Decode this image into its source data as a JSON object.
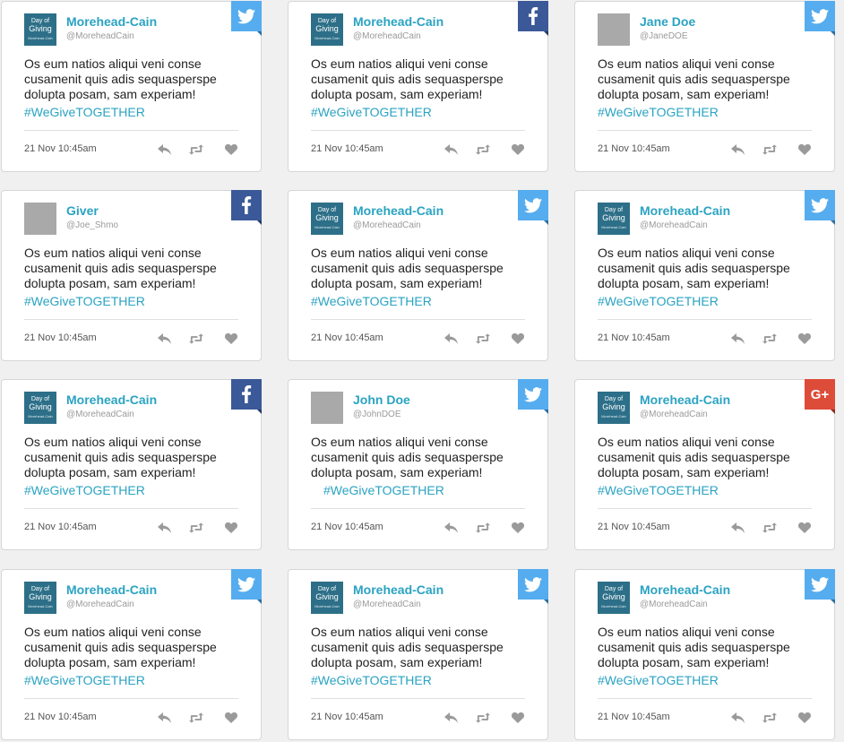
{
  "posts": [
    {
      "name": "Morehead-Cain",
      "handle": "@MoreheadCain",
      "avatar": "logo",
      "network": "twitter-icon",
      "text": "Os eum natios aliqui veni conse cusamenit quis adis sequasperspe dolupta posam, sam experiam!",
      "hashtag": "#WeGiveTOGETHER",
      "date": "21 Nov 10:45am"
    },
    {
      "name": "Morehead-Cain",
      "handle": "@MoreheadCain",
      "avatar": "logo",
      "network": "facebook-icon",
      "text": "Os eum natios aliqui veni conse cusamenit quis adis sequasperspe dolupta posam, sam experiam!",
      "hashtag": "#WeGiveTOGETHER",
      "date": "21 Nov 10:45am"
    },
    {
      "name": "Jane Doe",
      "handle": "@JaneDOE",
      "avatar": "grey",
      "network": "twitter-icon",
      "text": "Os eum natios aliqui veni conse cusamenit quis adis sequasperspe dolupta posam, sam experiam!",
      "hashtag": "#WeGiveTOGETHER",
      "date": "21 Nov 10:45am"
    },
    {
      "name": "Giver",
      "handle": "@Joe_Shmo",
      "avatar": "grey",
      "network": "facebook-icon",
      "text": "Os eum natios aliqui veni conse cusamenit quis adis sequasperspe dolupta posam, sam experiam!",
      "hashtag": "#WeGiveTOGETHER",
      "date": "21 Nov 10:45am"
    },
    {
      "name": "Morehead-Cain",
      "handle": "@MoreheadCain",
      "avatar": "logo",
      "network": "twitter-icon",
      "text": "Os eum natios aliqui veni conse cusamenit quis adis sequasperspe dolupta posam, sam experiam!",
      "hashtag": "#WeGiveTOGETHER",
      "date": "21 Nov 10:45am"
    },
    {
      "name": "Morehead-Cain",
      "handle": "@MoreheadCain",
      "avatar": "logo",
      "network": "twitter-icon",
      "text": "Os eum natios aliqui veni conse cusamenit quis adis sequasperspe dolupta posam, sam experiam!",
      "hashtag": "#WeGiveTOGETHER",
      "date": "21 Nov 10:45am"
    },
    {
      "name": "Morehead-Cain",
      "handle": "@MoreheadCain",
      "avatar": "logo",
      "network": "facebook-icon",
      "text": "Os eum natios aliqui veni conse cusamenit quis adis sequasperspe dolupta posam, sam experiam!",
      "hashtag": "#WeGiveTOGETHER",
      "date": "21 Nov 10:45am"
    },
    {
      "name": "John Doe",
      "handle": "@JohnDOE",
      "avatar": "grey",
      "network": "twitter-icon",
      "text": "Os eum natios aliqui veni conse cusamenit quis adis sequasperspe dolupta posam, sam experiam!",
      "hashtag": "#WeGiveTOGETHER",
      "date": "21 Nov 10:45am"
    },
    {
      "name": "Morehead-Cain",
      "handle": "@MoreheadCain",
      "avatar": "logo",
      "network": "google-plus-icon",
      "text": "Os eum natios aliqui veni conse cusamenit quis adis sequasperspe dolupta posam, sam experiam!",
      "hashtag": "#WeGiveTOGETHER",
      "date": "21 Nov 10:45am"
    },
    {
      "name": "Morehead-Cain",
      "handle": "@MoreheadCain",
      "avatar": "logo",
      "network": "twitter-icon",
      "text": "Os eum natios aliqui veni conse cusamenit quis adis sequasperspe dolupta posam, sam experiam!",
      "hashtag": "#WeGiveTOGETHER",
      "date": "21 Nov 10:45am"
    },
    {
      "name": "Morehead-Cain",
      "handle": "@MoreheadCain",
      "avatar": "logo",
      "network": "twitter-icon",
      "text": "Os eum natios aliqui veni conse cusamenit quis adis sequasperspe dolupta posam, sam experiam!",
      "hashtag": "#WeGiveTOGETHER",
      "date": "21 Nov 10:45am"
    },
    {
      "name": "Morehead-Cain",
      "handle": "@MoreheadCain",
      "avatar": "logo",
      "network": "twitter-icon",
      "text": "Os eum natios aliqui veni conse cusamenit quis adis sequasperspe dolupta posam, sam experiam!",
      "hashtag": "#WeGiveTOGETHER",
      "date": "21 Nov 10:45am"
    }
  ],
  "logo": {
    "line1": "Day of",
    "line2": "Giving",
    "line3": "Morehead-Cain"
  },
  "colors": {
    "accent": "#2aa3c2",
    "twitter": "#55acee",
    "facebook": "#3b5998",
    "google": "#dd4b39",
    "logo_bg": "#2d6f88"
  }
}
